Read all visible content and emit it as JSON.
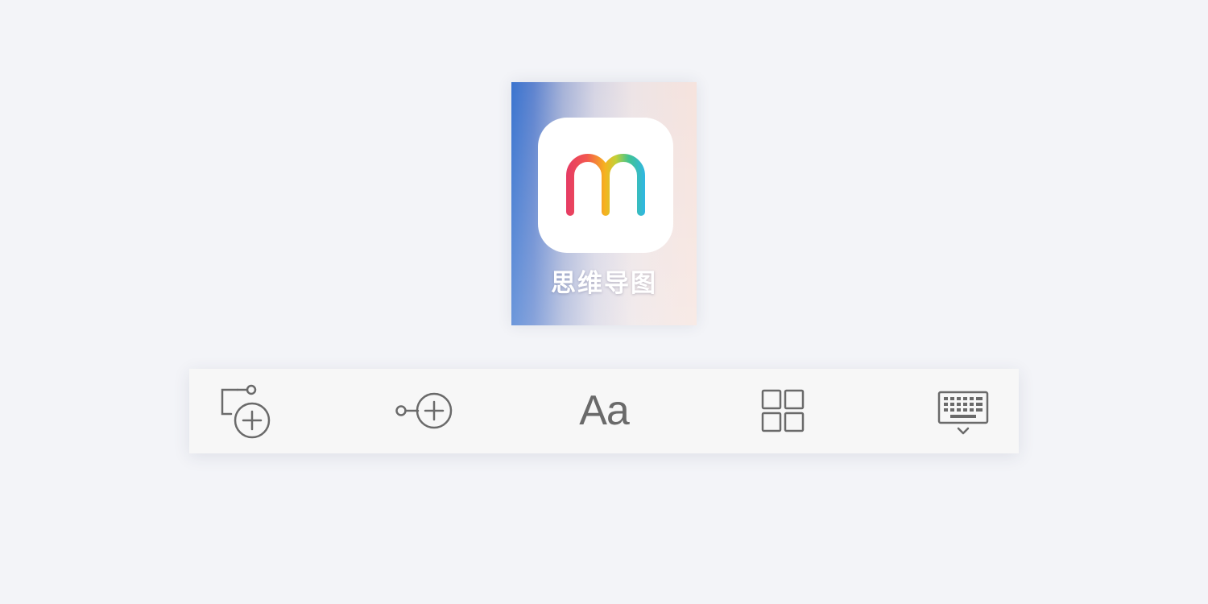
{
  "app": {
    "label": "思维导图",
    "icon": "rainbow-m-logo",
    "logo_letter": "m",
    "colors": {
      "tile_left": "#3a74cf",
      "tile_right": "#f6e3dd",
      "logo_red": "#e63c64",
      "logo_yellow": "#f6b21f",
      "logo_blue": "#2fb6e8"
    }
  },
  "toolbar": {
    "background": "#f7f7f7",
    "icon_color": "#6a6a6a",
    "items": [
      {
        "id": "add-subtopic",
        "icon": "add-subtopic-icon"
      },
      {
        "id": "add-sibling",
        "icon": "add-sibling-node-icon"
      },
      {
        "id": "text-format",
        "icon": "text-format-icon",
        "label": "Aa"
      },
      {
        "id": "layout",
        "icon": "grid-layout-icon"
      },
      {
        "id": "keyboard",
        "icon": "keyboard-hide-icon"
      }
    ]
  }
}
